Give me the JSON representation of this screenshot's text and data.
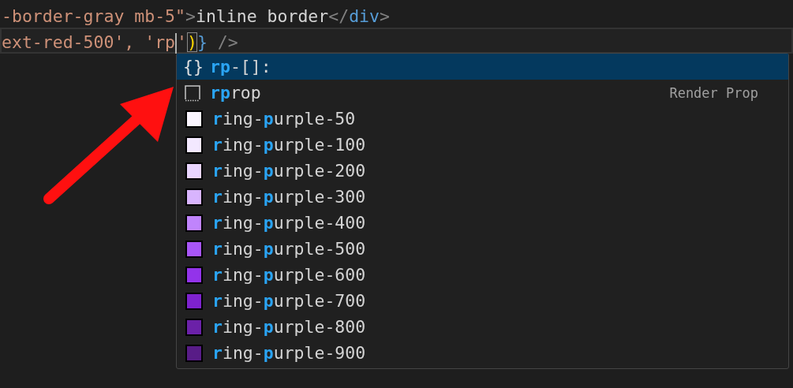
{
  "code_lines": [
    {
      "current": false,
      "tokens": [
        {
          "kind": "string",
          "text": "-border-gray mb-5\""
        },
        {
          "kind": "punct",
          "text": ">"
        },
        {
          "kind": "plain",
          "text": "inline border"
        },
        {
          "kind": "punct",
          "text": "</"
        },
        {
          "kind": "tag",
          "text": "div"
        },
        {
          "kind": "punct",
          "text": ">"
        }
      ]
    },
    {
      "current": true,
      "tokens": [
        {
          "kind": "string",
          "text": "ext-red-500', 'rp"
        },
        {
          "kind": "cursor"
        },
        {
          "kind": "string",
          "text": "'"
        },
        {
          "kind": "bracket",
          "text": ")"
        },
        {
          "kind": "tag",
          "text": "}"
        },
        {
          "kind": "punct",
          "text": " />"
        }
      ]
    }
  ],
  "suggestions": [
    {
      "kind": "snippet",
      "glyph": "{}",
      "label": "**rp**-[]:",
      "selected": true
    },
    {
      "kind": "property",
      "label": "**rp**rop",
      "detail": "Render Prop",
      "selected": false
    },
    {
      "kind": "color",
      "label": "**r**ing-**p**urple-50",
      "color": "#faf5ff",
      "selected": false
    },
    {
      "kind": "color",
      "label": "**r**ing-**p**urple-100",
      "color": "#f3e8ff",
      "selected": false
    },
    {
      "kind": "color",
      "label": "**r**ing-**p**urple-200",
      "color": "#e9d5ff",
      "selected": false
    },
    {
      "kind": "color",
      "label": "**r**ing-**p**urple-300",
      "color": "#d8b4fe",
      "selected": false
    },
    {
      "kind": "color",
      "label": "**r**ing-**p**urple-400",
      "color": "#c084fc",
      "selected": false
    },
    {
      "kind": "color",
      "label": "**r**ing-**p**urple-500",
      "color": "#a855f7",
      "selected": false
    },
    {
      "kind": "color",
      "label": "**r**ing-**p**urple-600",
      "color": "#9333ea",
      "selected": false
    },
    {
      "kind": "color",
      "label": "**r**ing-**p**urple-700",
      "color": "#7e22ce",
      "selected": false
    },
    {
      "kind": "color",
      "label": "**r**ing-**p**urple-800",
      "color": "#6b21a8",
      "selected": false
    },
    {
      "kind": "color",
      "label": "**r**ing-**p**urple-900",
      "color": "#581c87",
      "selected": false
    }
  ]
}
